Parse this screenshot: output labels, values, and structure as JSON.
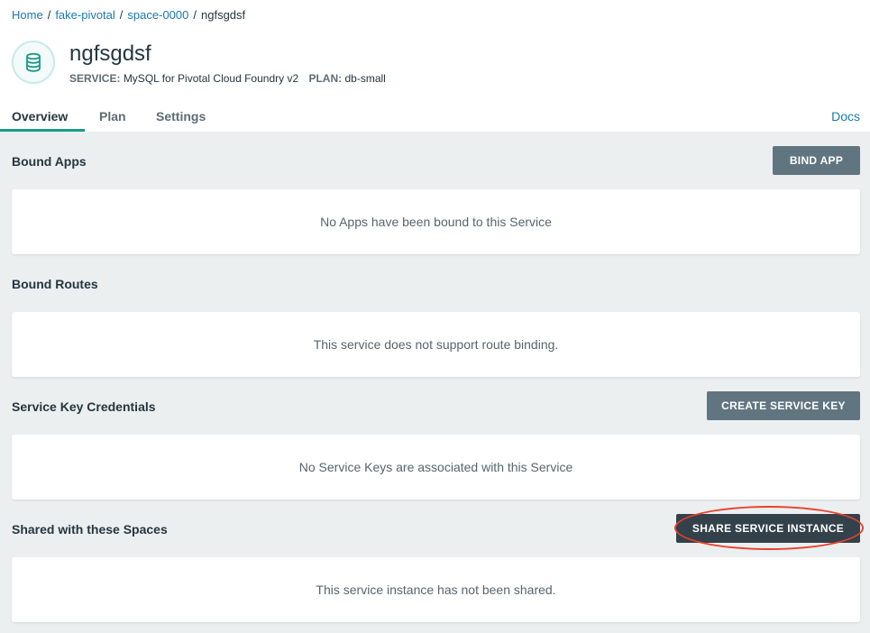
{
  "breadcrumb": {
    "items": [
      {
        "label": "Home"
      },
      {
        "label": "fake-pivotal"
      },
      {
        "label": "space-0000"
      }
    ],
    "current": "ngfsgdsf",
    "separator": "/"
  },
  "service": {
    "name": "ngfsgdsf",
    "service_key": "SERVICE:",
    "service_value": "MySQL for Pivotal Cloud Foundry v2",
    "plan_key": "PLAN:",
    "plan_value": "db-small",
    "icon": "database-icon"
  },
  "tabs": [
    {
      "label": "Overview",
      "active": true
    },
    {
      "label": "Plan",
      "active": false
    },
    {
      "label": "Settings",
      "active": false
    }
  ],
  "docs_link": "Docs",
  "sections": {
    "bound_apps": {
      "title": "Bound Apps",
      "button": "BIND APP",
      "empty": "No Apps have been bound to this Service"
    },
    "bound_routes": {
      "title": "Bound Routes",
      "empty": "This service does not support route binding."
    },
    "service_keys": {
      "title": "Service Key Credentials",
      "button": "CREATE SERVICE KEY",
      "empty": "No Service Keys are associated with this Service"
    },
    "shared_spaces": {
      "title": "Shared with these Spaces",
      "button": "SHARE SERVICE INSTANCE",
      "empty": "This service instance has not been shared."
    }
  },
  "colors": {
    "accent": "#1b9a89",
    "link": "#1b78b3",
    "button": "#607580",
    "button_dark": "#33414a",
    "highlight": "#e8422c",
    "background": "#eceff0"
  }
}
